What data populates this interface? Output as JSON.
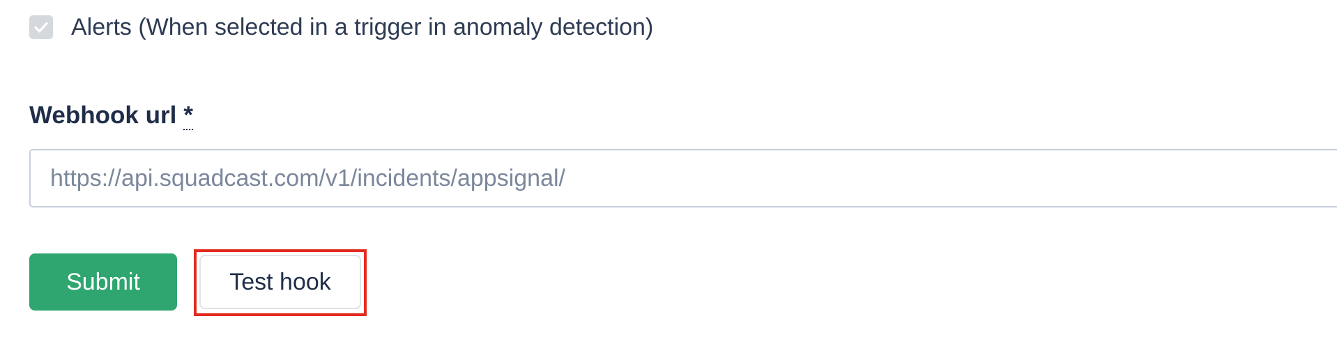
{
  "checkbox": {
    "label": "Alerts (When selected in a trigger in anomaly detection)",
    "checked": true,
    "icon": "checkmark-icon"
  },
  "webhook": {
    "label": "Webhook url",
    "required_marker": "*",
    "value": "https://api.squadcast.com/v1/incidents/appsignal/"
  },
  "buttons": {
    "submit_label": "Submit",
    "test_label": "Test hook"
  },
  "colors": {
    "submit_bg": "#2fa570",
    "highlight": "#e32a1f",
    "text": "#1f2d48"
  }
}
